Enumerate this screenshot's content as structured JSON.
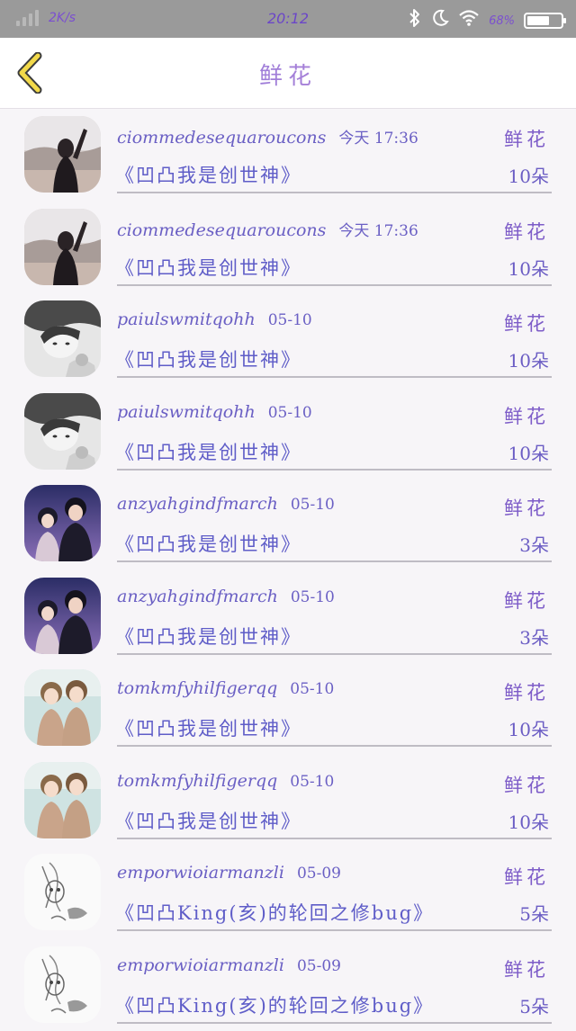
{
  "status_bar": {
    "speed": "2K/s",
    "time": "20:12",
    "battery_percent": "68%",
    "battery_level": 0.68,
    "icons": [
      "signal-icon",
      "bluetooth-icon",
      "moon-icon",
      "wifi-icon",
      "battery-icon"
    ]
  },
  "header": {
    "back_icon": "chevron-left-icon",
    "title": "鲜花"
  },
  "colors": {
    "accent": "#7d5cc8",
    "title_gradient_start": "#7c6ee0",
    "title_gradient_end": "#c98fd0",
    "status_bar_bg": "#9a9a9a"
  },
  "records": [
    {
      "avatar": "girl-winter-photo",
      "username": "ciommedesequaroucons",
      "time": "今天 17:36",
      "gift": "鲜花",
      "book": "《凹凸我是创世神》",
      "count": "10朵"
    },
    {
      "avatar": "girl-winter-photo",
      "username": "ciommedesequaroucons",
      "time": "今天 17:36",
      "gift": "鲜花",
      "book": "《凹凸我是创世神》",
      "count": "10朵"
    },
    {
      "avatar": "girl-bw-photo",
      "username": "paiulswmitqohh",
      "time": "05-10",
      "gift": "鲜花",
      "book": "《凹凸我是创世神》",
      "count": "10朵"
    },
    {
      "avatar": "girl-bw-photo",
      "username": "paiulswmitqohh",
      "time": "05-10",
      "gift": "鲜花",
      "book": "《凹凸我是创世神》",
      "count": "10朵"
    },
    {
      "avatar": "anime-couple-photo",
      "username": "anzyahgindfmarch",
      "time": "05-10",
      "gift": "鲜花",
      "book": "《凹凸我是创世神》",
      "count": "3朵"
    },
    {
      "avatar": "anime-couple-photo",
      "username": "anzyahgindfmarch",
      "time": "05-10",
      "gift": "鲜花",
      "book": "《凹凸我是创世神》",
      "count": "3朵"
    },
    {
      "avatar": "kids-photo",
      "username": "tomkmfyhilfigerqq",
      "time": "05-10",
      "gift": "鲜花",
      "book": "《凹凸我是创世神》",
      "count": "10朵"
    },
    {
      "avatar": "kids-photo",
      "username": "tomkmfyhilfigerqq",
      "time": "05-10",
      "gift": "鲜花",
      "book": "《凹凸我是创世神》",
      "count": "10朵"
    },
    {
      "avatar": "sketch-drawing",
      "username": "emporwioiarmanzli",
      "time": "05-09",
      "gift": "鲜花",
      "book": "《凹凸King(亥)的轮回之修bug》",
      "count": "5朵"
    },
    {
      "avatar": "sketch-drawing",
      "username": "emporwioiarmanzli",
      "time": "05-09",
      "gift": "鲜花",
      "book": "《凹凸King(亥)的轮回之修bug》",
      "count": "5朵"
    }
  ]
}
